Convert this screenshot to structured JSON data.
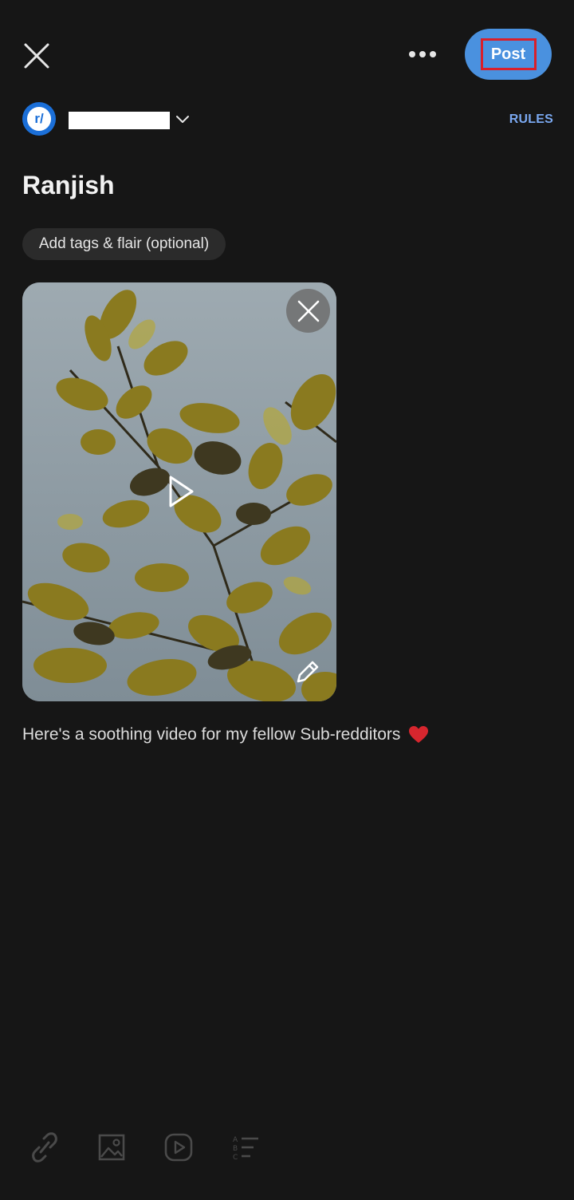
{
  "header": {
    "close_icon": "close-icon",
    "more_icon": "more-horizontal-icon",
    "post_label": "Post",
    "post_color": "#4a91df",
    "highlight_color": "#d91f2a"
  },
  "community": {
    "avatar_text": "r/",
    "avatar_color": "#1b6fd8",
    "rules_label": "RULES"
  },
  "post": {
    "title": "Ranjish",
    "tags_label": "Add tags & flair (optional)",
    "body": "Here's a soothing video for my fellow Sub-redditors",
    "body_emoji": "heart-icon"
  },
  "media": {
    "remove_icon": "close-icon",
    "play_icon": "play-icon",
    "edit_icon": "pencil-icon"
  },
  "toolbar": {
    "items": [
      {
        "icon": "link-icon"
      },
      {
        "icon": "image-icon"
      },
      {
        "icon": "video-icon"
      },
      {
        "icon": "list-icon"
      }
    ]
  }
}
